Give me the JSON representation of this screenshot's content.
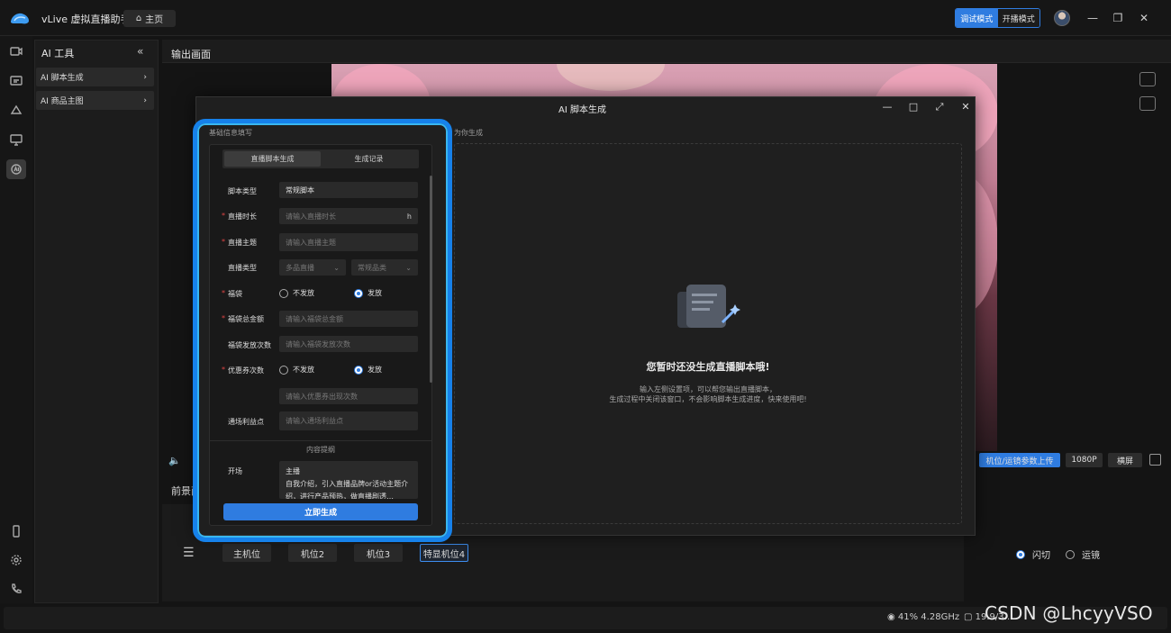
{
  "app": {
    "title": "vLive 虚拟直播助手",
    "home_tab": "主页",
    "mode_debug": "调试模式",
    "mode_live": "开播模式"
  },
  "ai_panel": {
    "title": "AI 工具",
    "items": [
      {
        "label": "AI 脚本生成"
      },
      {
        "label": "AI 商品主图"
      }
    ]
  },
  "output": {
    "title": "输出画面",
    "buttons": {
      "upload": "机位/运镜参数上传",
      "resolution": "1080P",
      "orientation": "横屏"
    }
  },
  "front_label": "前景面",
  "cameras": {
    "items": [
      "主机位",
      "机位2",
      "机位3",
      "特显机位4"
    ],
    "modes": [
      {
        "label": "闪切",
        "selected": true
      },
      {
        "label": "运镜",
        "selected": false
      }
    ]
  },
  "status": {
    "cpu": "41% 4.28GHz",
    "mem": "19.9/3…"
  },
  "watermark": "CSDN @LhcyyVSO",
  "modal": {
    "title": "AI 脚本生成",
    "form_section": "基础信息填写",
    "gen_section": "为你生成",
    "tabs": {
      "script": "直播脚本生成",
      "history": "生成记录"
    },
    "fields": {
      "script_type": {
        "label": "脚本类型",
        "value": "常规脚本"
      },
      "duration": {
        "label": "直播时长",
        "placeholder": "请输入直播时长",
        "unit": "h"
      },
      "topic": {
        "label": "直播主题",
        "placeholder": "请输入直播主题"
      },
      "live_type": {
        "label": "直播类型",
        "value1": "多品直播",
        "value2": "常规品类"
      },
      "bag": {
        "label": "福袋",
        "opt_no": "不发放",
        "opt_yes": "发放"
      },
      "bag_amount": {
        "label": "福袋总金额",
        "placeholder": "请输入福袋总金额"
      },
      "bag_times": {
        "label": "福袋发放次数",
        "placeholder": "请输入福袋发放次数"
      },
      "coupon": {
        "label": "优惠券次数",
        "opt_no": "不发放",
        "opt_yes": "发放"
      },
      "coupon_times": {
        "placeholder": "请输入优惠券出现次数"
      },
      "benefit": {
        "label": "通场利益点",
        "placeholder": "请输入通场利益点"
      }
    },
    "outline_label": "内容提纲",
    "opening": {
      "label": "开场",
      "role": "主播",
      "text": "自我介绍，引入直播品牌or活动主题介绍，进行产品预热，做直播剧透…"
    },
    "submit": "立即生成",
    "empty": {
      "title": "您暂时还没生成直播脚本哦!",
      "desc1": "输入左侧设置项，可以帮您输出直播脚本，",
      "desc2": "生成过程中关闭该窗口，不会影响脚本生成进度，快来使用吧!"
    }
  },
  "colors": {
    "accent": "#2f7ce0",
    "highlight": "#1681ea",
    "required": "#e04545"
  }
}
